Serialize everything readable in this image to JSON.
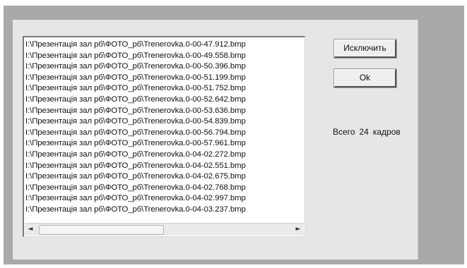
{
  "file_list": {
    "items": [
      "I:\\Презентація зал рб\\ФОТО_рб\\Trenerovka.0-00-47.912.bmp",
      "I:\\Презентація зал рб\\ФОТО_рб\\Trenerovka.0-00-49.558.bmp",
      "I:\\Презентація зал рб\\ФОТО_рб\\Trenerovka.0-00-50.396.bmp",
      "I:\\Презентація зал рб\\ФОТО_рб\\Trenerovka.0-00-51.199.bmp",
      "I:\\Презентація зал рб\\ФОТО_рб\\Trenerovka.0-00-51.752.bmp",
      "I:\\Презентація зал рб\\ФОТО_рб\\Trenerovka.0-00-52.642.bmp",
      "I:\\Презентація зал рб\\ФОТО_рб\\Trenerovka.0-00-53.636.bmp",
      "I:\\Презентація зал рб\\ФОТО_рб\\Trenerovka.0-00-54.839.bmp",
      "I:\\Презентація зал рб\\ФОТО_рб\\Trenerovka.0-00-56.794.bmp",
      "I:\\Презентація зал рб\\ФОТО_рб\\Trenerovka.0-00-57.961.bmp",
      "I:\\Презентація зал рб\\ФОТО_рб\\Trenerovka.0-04-02.272.bmp",
      "I:\\Презентація зал рб\\ФОТО_рб\\Trenerovka.0-04-02.551.bmp",
      "I:\\Презентація зал рб\\ФОТО_рб\\Trenerovka.0-04-02.675.bmp",
      "I:\\Презентація зал рб\\ФОТО_рб\\Trenerovka.0-04-02.768.bmp",
      "I:\\Презентація зал рб\\ФОТО_рб\\Trenerovka.0-04-02.997.bmp",
      "I:\\Презентація зал рб\\ФОТО_рб\\Trenerovka.0-04-03.237.bmp"
    ],
    "scrollbar": {
      "left_arrow_icon": "scroll-left-arrow-icon",
      "left_arrow_glyph": "◄",
      "right_arrow_icon": "scroll-right-arrow-icon",
      "right_arrow_glyph": "►"
    }
  },
  "buttons": {
    "exclude_label": "Исключить",
    "ok_label": "Ok"
  },
  "summary": {
    "prefix": "Всего",
    "count": "24",
    "suffix": "кадров"
  },
  "colors": {
    "frame": "#a9a9a9",
    "dialog": "#e6e6e6",
    "list_background": "#ffffff"
  }
}
